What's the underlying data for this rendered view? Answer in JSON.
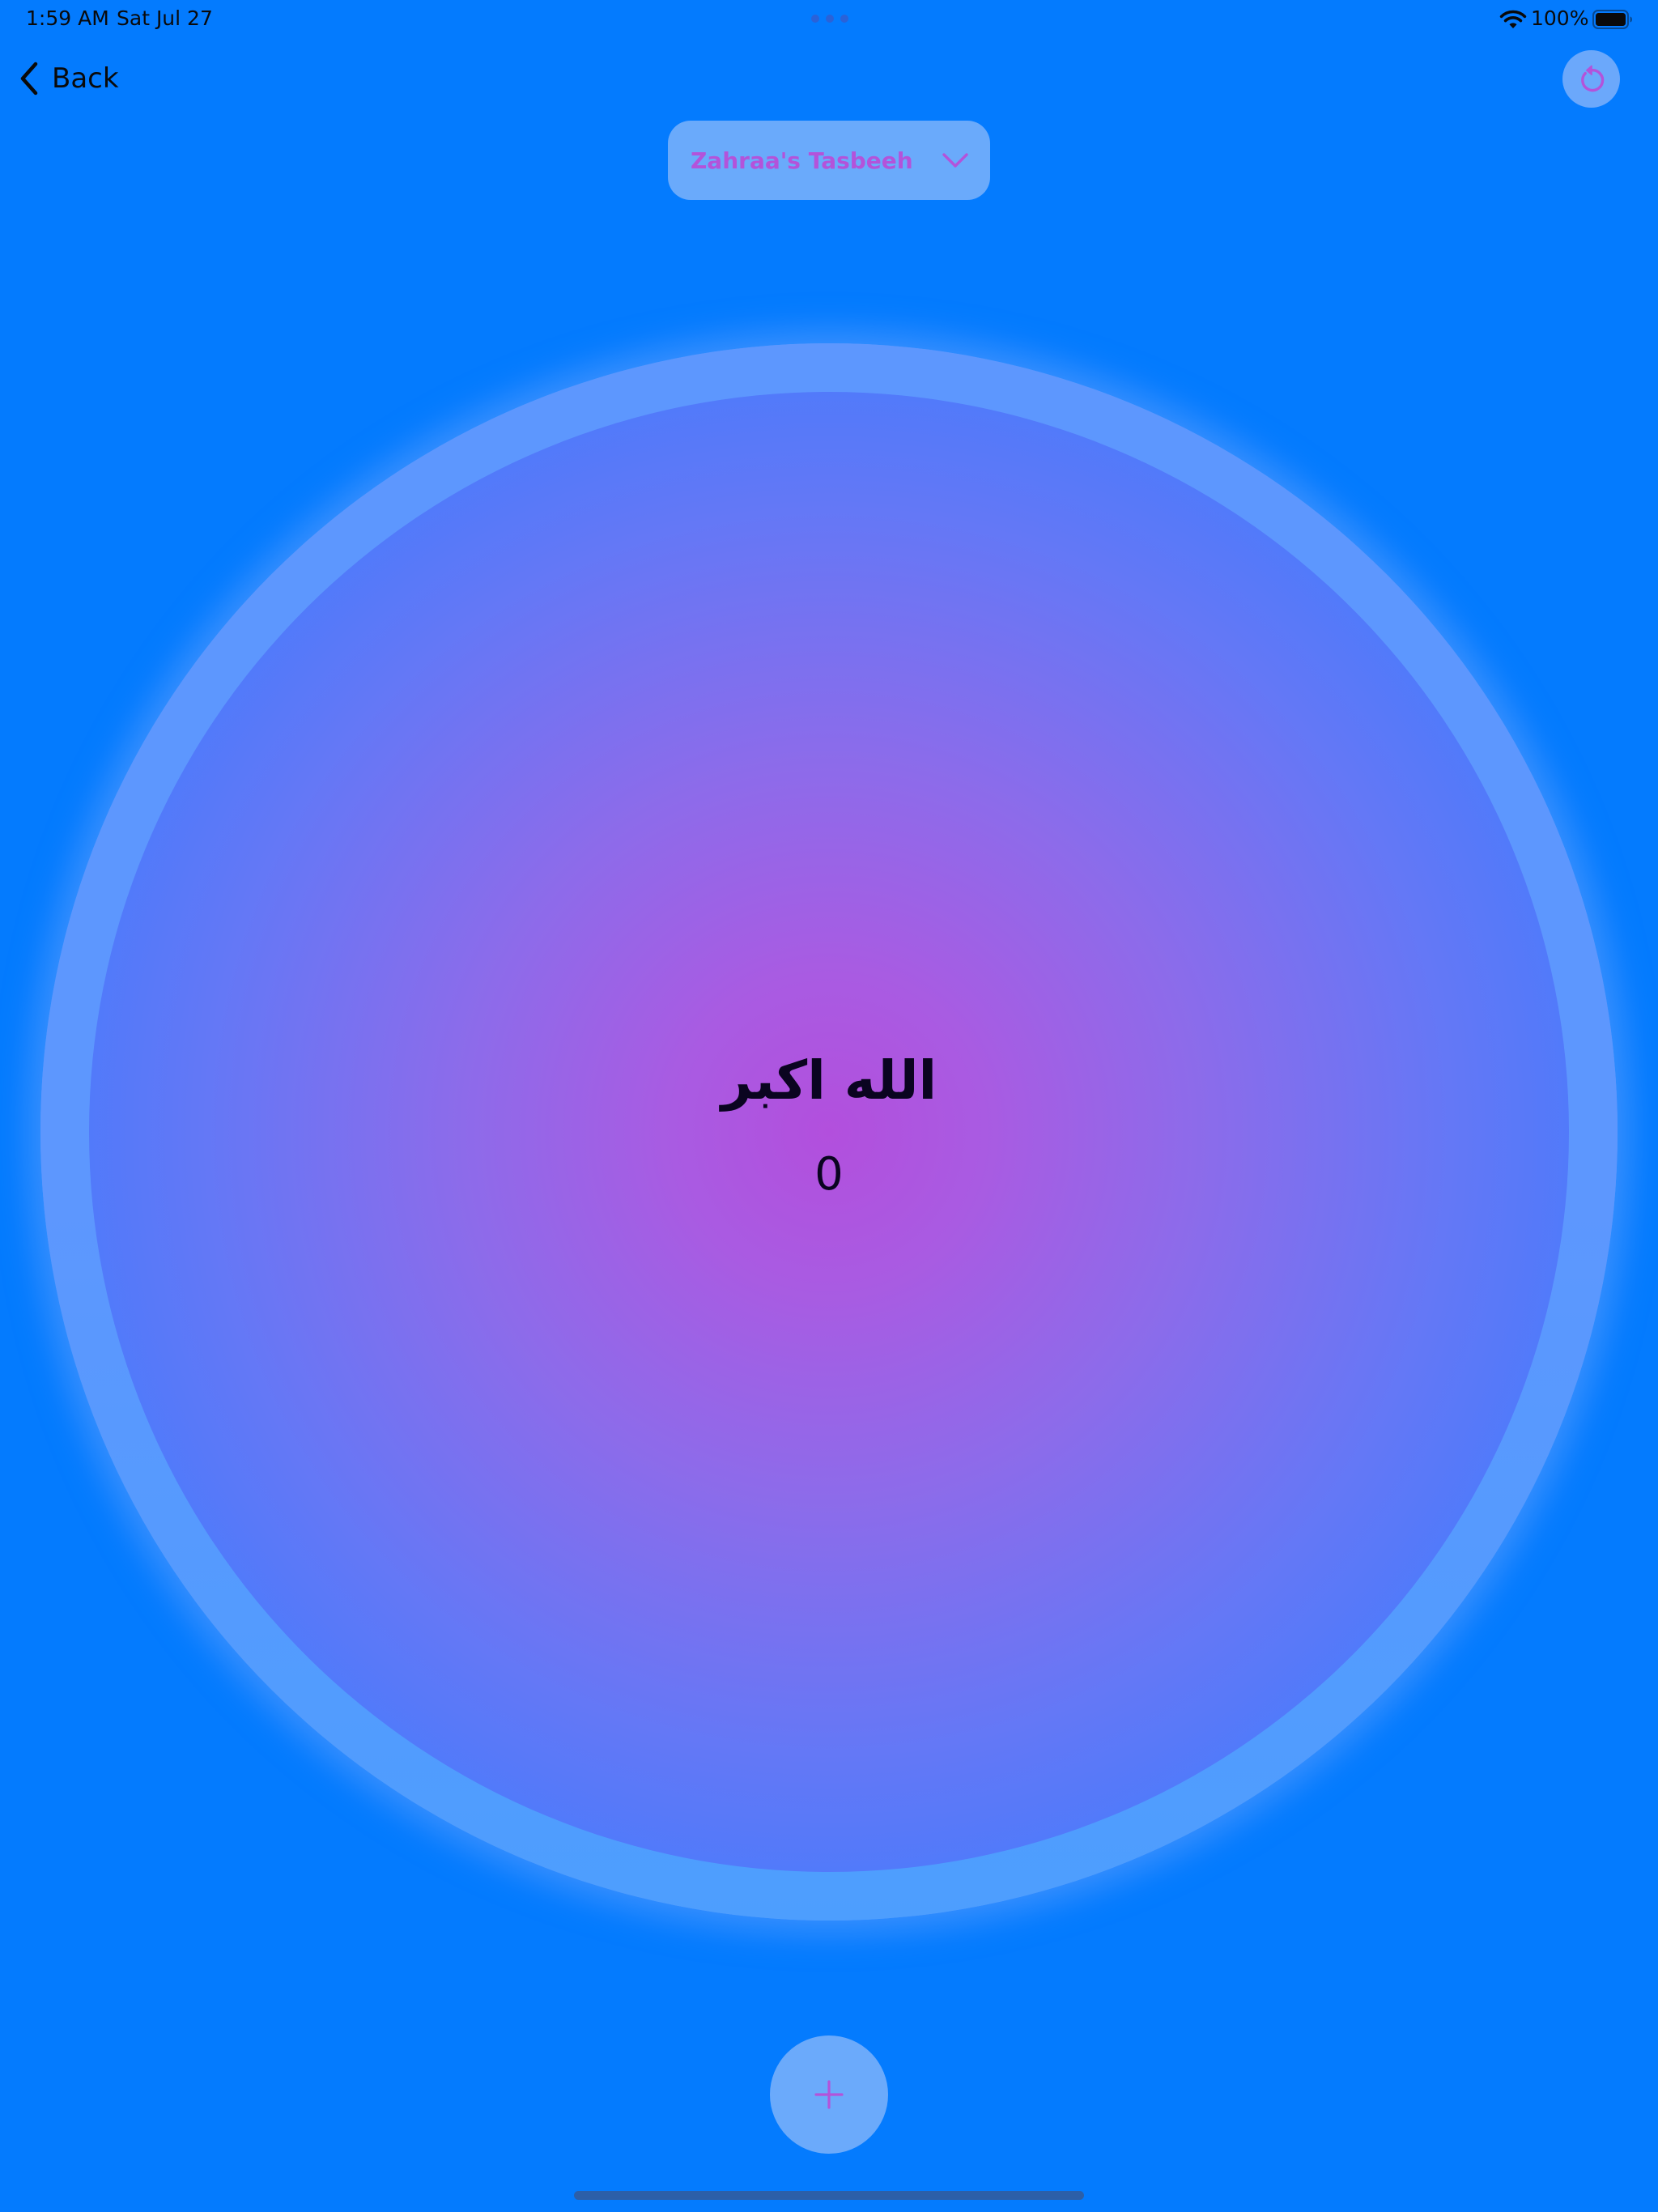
{
  "status_bar": {
    "time": "1:59 AM",
    "date": "Sat Jul 27",
    "battery_percent": "100%",
    "icons": [
      "multitask-dots-icon",
      "wifi-icon",
      "battery-icon"
    ]
  },
  "nav": {
    "back_label": "Back",
    "reset_icon": "reset-icon"
  },
  "dropdown": {
    "selected": "Zahraa's Tasbeeh",
    "icon": "chevron-down-icon"
  },
  "counter": {
    "dhikr": "الله اكبر",
    "count": "0"
  },
  "increment": {
    "icon": "plus-icon"
  },
  "colors": {
    "background": "#047bfe",
    "accent": "#b353da",
    "ring": "#5d97fe",
    "button_fill": "#6baafb",
    "gradient_center": "#b24fdd",
    "gradient_edge": "#3479ff"
  }
}
